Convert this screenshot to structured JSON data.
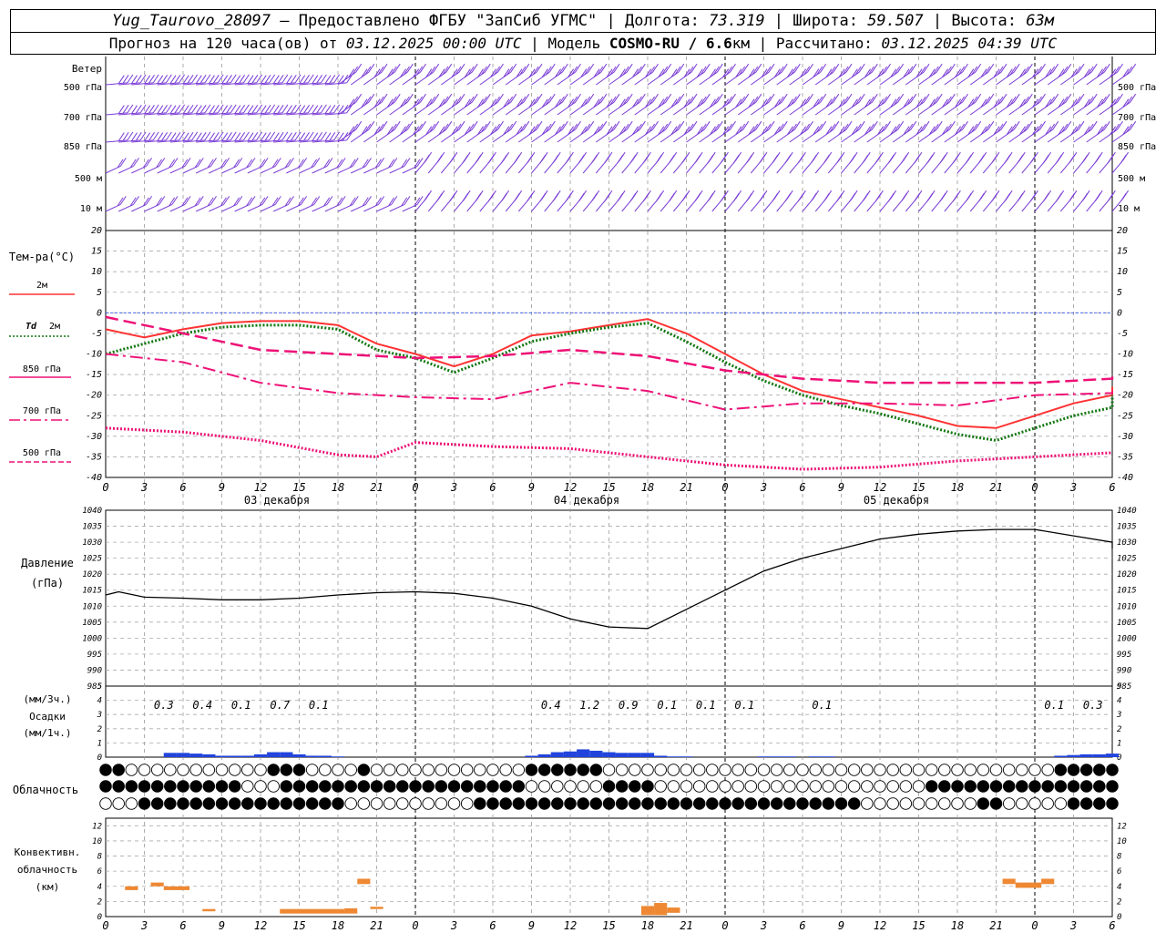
{
  "header": {
    "station": "Yug_Taurovo_28097",
    "provided_by": "– Предоставлено ФГБУ \"ЗапСиб УГМС\"",
    "lon_label": "Долгота:",
    "lon": "73.319",
    "lat_label": "Широта:",
    "lat": "59.507",
    "alt_label": "Высота:",
    "alt": "63м",
    "forecast_label": "Прогноз на 120 часа(ов) от",
    "forecast_start": "03.12.2025 00:00 UTC",
    "model_label": "Модель",
    "model": "COSMO-RU / 6.6",
    "model_unit": "км",
    "computed_label": "Рассчитано:",
    "computed": "03.12.2025 04:39 UTC"
  },
  "colors": {
    "wind": "#7a3cd6",
    "t2m": "#ff3333",
    "td2m": "#117711",
    "t850": "#ee1177",
    "t700": "#ee1177",
    "t500": "#ee1177",
    "pressure": "#000000",
    "precip": "#2244dd",
    "convective": "#ee8833",
    "zero_line": "#3355ee"
  },
  "time_axis": {
    "ticks": [
      "0",
      "3",
      "6",
      "9",
      "12",
      "15",
      "18",
      "21",
      "0",
      "3",
      "6",
      "9",
      "12",
      "15",
      "18",
      "21",
      "0",
      "3",
      "6",
      "9",
      "12",
      "15",
      "18",
      "21",
      "0",
      "3",
      "6"
    ],
    "days": [
      "03 декабря",
      "04 декабря",
      "05 декабря"
    ]
  },
  "wind_panel": {
    "title": "Ветер",
    "levels": [
      "500 гПа",
      "700 гПа",
      "850 гПа",
      "500 м",
      "10 м"
    ]
  },
  "chart_data": [
    {
      "type": "line",
      "title": "Тем-ра(°С)",
      "x_unit": "hours from 03.12.2025 00 UTC",
      "ylim": [
        -40,
        20
      ],
      "y_ticks": [
        20,
        15,
        10,
        5,
        0,
        -5,
        -10,
        -15,
        -20,
        -25,
        -30,
        -35,
        -40
      ],
      "series": [
        {
          "name": "2м",
          "key": "t2m",
          "style": "solid",
          "x": [
            0,
            3,
            6,
            9,
            12,
            15,
            18,
            21,
            24,
            27,
            30,
            33,
            36,
            39,
            42,
            45,
            48,
            51,
            54,
            57,
            60,
            63,
            66,
            69,
            72,
            75,
            78,
            81
          ],
          "values": [
            -4,
            -6,
            -4,
            -2.5,
            -2,
            -2,
            -3,
            -7.5,
            -10,
            -13,
            -10,
            -5.5,
            -4.5,
            -3,
            -1.5,
            -5,
            -10,
            -15,
            -19,
            -21,
            -23,
            -25,
            -27.5,
            -28,
            -25,
            -22,
            -20,
            -18
          ]
        },
        {
          "name": "Td 2м",
          "key": "td2m",
          "style": "dotted",
          "x": [
            0,
            3,
            6,
            9,
            12,
            15,
            18,
            21,
            24,
            27,
            30,
            33,
            36,
            39,
            42,
            45,
            48,
            51,
            54,
            57,
            60,
            63,
            66,
            69,
            72,
            75,
            78,
            81
          ],
          "values": [
            -10,
            -7.5,
            -5,
            -3.5,
            -3,
            -3,
            -4,
            -9,
            -11,
            -14.5,
            -11,
            -7,
            -5,
            -3.5,
            -2.5,
            -7,
            -12,
            -16.5,
            -20,
            -22.5,
            -24.5,
            -27,
            -29.5,
            -31,
            -28,
            -25,
            -23,
            -20
          ]
        },
        {
          "name": "850 гПа",
          "key": "t850",
          "style": "dash",
          "x": [
            0,
            6,
            12,
            18,
            24,
            30,
            36,
            42,
            48,
            54,
            60,
            66,
            72,
            78,
            81
          ],
          "values": [
            -1,
            -5,
            -9,
            -10,
            -11,
            -10.5,
            -9,
            -10.5,
            -14,
            -16,
            -17,
            -17,
            -17,
            -16,
            -15
          ]
        },
        {
          "name": "700 гПа",
          "key": "t700",
          "style": "dashdot",
          "x": [
            0,
            6,
            12,
            18,
            24,
            30,
            36,
            42,
            48,
            54,
            60,
            66,
            72,
            78,
            81
          ],
          "values": [
            -10,
            -12,
            -17,
            -19.5,
            -20.5,
            -21,
            -17,
            -19,
            -23.5,
            -22,
            -22,
            -22.5,
            -20,
            -19.5,
            -19
          ]
        },
        {
          "name": "500 гПа",
          "key": "t500",
          "style": "dotted",
          "x": [
            0,
            6,
            12,
            18,
            21,
            24,
            30,
            36,
            42,
            48,
            54,
            60,
            66,
            72,
            78,
            81
          ],
          "values": [
            -28,
            -29,
            -31,
            -34.5,
            -35,
            -31.5,
            -32.5,
            -33,
            -35,
            -37,
            -38,
            -37.5,
            -36,
            -35,
            -34,
            -34
          ]
        }
      ]
    },
    {
      "type": "line",
      "title": "Давление (гПа)",
      "ylim": [
        985,
        1040
      ],
      "y_ticks": [
        1040,
        1035,
        1030,
        1025,
        1020,
        1015,
        1010,
        1005,
        1000,
        995,
        990,
        985
      ],
      "series": [
        {
          "name": "Давление",
          "key": "pressure",
          "x": [
            0,
            1,
            3,
            6,
            9,
            12,
            15,
            18,
            21,
            24,
            27,
            30,
            33,
            36,
            39,
            42,
            45,
            48,
            51,
            54,
            57,
            60,
            63,
            66,
            69,
            72,
            75,
            78,
            81
          ],
          "values": [
            1013.5,
            1014.5,
            1012.8,
            1012.5,
            1012,
            1012,
            1012.5,
            1013.5,
            1014.2,
            1014.5,
            1014,
            1012.5,
            1010,
            1006,
            1003.5,
            1003,
            1009,
            1015,
            1021,
            1025,
            1028,
            1031,
            1032.5,
            1033.5,
            1034,
            1034,
            1032,
            1030,
            1028
          ]
        }
      ]
    },
    {
      "type": "bar",
      "title": "(мм/3ч.) Осадки (мм/1ч.)",
      "ylim": [
        0,
        5
      ],
      "y_ticks": [
        5,
        4,
        3,
        2,
        1,
        0
      ],
      "labels": [
        {
          "x": 4.5,
          "text": "0.3"
        },
        {
          "x": 7.5,
          "text": "0.4"
        },
        {
          "x": 10.5,
          "text": "0.1"
        },
        {
          "x": 13.5,
          "text": "0.7"
        },
        {
          "x": 16.5,
          "text": "0.1"
        },
        {
          "x": 34.5,
          "text": "0.4"
        },
        {
          "x": 37.5,
          "text": "1.2"
        },
        {
          "x": 40.5,
          "text": "0.9"
        },
        {
          "x": 43.5,
          "text": "0.1"
        },
        {
          "x": 46.5,
          "text": "0.1"
        },
        {
          "x": 49.5,
          "text": "0.1"
        },
        {
          "x": 55.5,
          "text": "0.1"
        },
        {
          "x": 73.5,
          "text": "0.1"
        },
        {
          "x": 76.5,
          "text": "0.3"
        }
      ],
      "bars": {
        "x": [
          5,
          6,
          7,
          8,
          9,
          10,
          11,
          12,
          13,
          14,
          15,
          16,
          17,
          18,
          33,
          34,
          35,
          36,
          37,
          38,
          39,
          40,
          41,
          42,
          43,
          44,
          45,
          51,
          52,
          53,
          55,
          56,
          74,
          75,
          76,
          77,
          78
        ],
        "values": [
          0.3,
          0.3,
          0.25,
          0.2,
          0.1,
          0.1,
          0.1,
          0.2,
          0.35,
          0.35,
          0.2,
          0.1,
          0.1,
          0.05,
          0.1,
          0.2,
          0.35,
          0.4,
          0.55,
          0.45,
          0.35,
          0.3,
          0.3,
          0.3,
          0.1,
          0.05,
          0.05,
          0.05,
          0.05,
          0.05,
          0.05,
          0.05,
          0.1,
          0.15,
          0.2,
          0.2,
          0.25
        ]
      }
    },
    {
      "type": "bar",
      "title": "Конвективн. облачность (км)",
      "ylim": [
        0,
        13
      ],
      "y_ticks": [
        12,
        10,
        8,
        6,
        4,
        2,
        0
      ],
      "segments": [
        {
          "x0": 1.5,
          "x1": 2.5,
          "top": 4,
          "base": 3.5
        },
        {
          "x0": 3.5,
          "x1": 4.5,
          "top": 4.5,
          "base": 4
        },
        {
          "x0": 4.5,
          "x1": 6.5,
          "top": 4,
          "base": 3.5
        },
        {
          "x0": 7.5,
          "x1": 8.5,
          "top": 1,
          "base": 0.7
        },
        {
          "x0": 13.5,
          "x1": 18.5,
          "top": 1,
          "base": 0.4
        },
        {
          "x0": 18.5,
          "x1": 19.5,
          "top": 1.1,
          "base": 0.4
        },
        {
          "x0": 19.5,
          "x1": 20.5,
          "top": 5,
          "base": 4.3
        },
        {
          "x0": 20.5,
          "x1": 21.5,
          "top": 1.3,
          "base": 1
        },
        {
          "x0": 41.5,
          "x1": 42.5,
          "top": 1.4,
          "base": 0.2
        },
        {
          "x0": 42.5,
          "x1": 43.5,
          "top": 1.8,
          "base": 0.2
        },
        {
          "x0": 43.5,
          "x1": 44.5,
          "top": 1.2,
          "base": 0.5
        },
        {
          "x0": 69.5,
          "x1": 70.5,
          "top": 5,
          "base": 4.3
        },
        {
          "x0": 70.5,
          "x1": 72.5,
          "top": 4.5,
          "base": 3.8
        },
        {
          "x0": 72.5,
          "x1": 73.5,
          "top": 5,
          "base": 4.3
        }
      ]
    }
  ],
  "legend": {
    "temp_title": "Тем-ра(°С)",
    "t2m": "2м",
    "td_sym": "Td",
    "td": "2м",
    "t850": "850 гПа",
    "t700": "700 гПа",
    "t500": "500 гПа"
  },
  "pressure_labels": {
    "l1": "Давление",
    "l2": "(гПа)"
  },
  "precip_labels": {
    "l1": "(мм/3ч.)",
    "l2": "Осадки",
    "l3": "(мм/1ч.)"
  },
  "cloud_label": "Облачность",
  "conv_labels": {
    "l1": "Конвективн.",
    "l2": "облачность",
    "l3": "(км)"
  }
}
